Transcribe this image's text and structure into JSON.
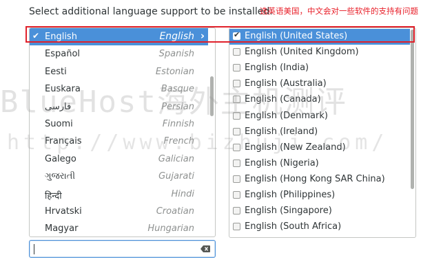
{
  "header": {
    "label": "Select additional language support to be installed:",
    "annotation": "选英语美国，中文会对一些软件的支持有问题"
  },
  "languages": [
    {
      "native": "English",
      "english": "English",
      "selected": true
    },
    {
      "native": "Español",
      "english": "Spanish"
    },
    {
      "native": "Eesti",
      "english": "Estonian"
    },
    {
      "native": "Euskara",
      "english": "Basque"
    },
    {
      "native": "فارسی",
      "english": "Persian"
    },
    {
      "native": "Suomi",
      "english": "Finnish"
    },
    {
      "native": "Français",
      "english": "French"
    },
    {
      "native": "Galego",
      "english": "Galician"
    },
    {
      "native": "ગુજરાતી",
      "english": "Gujarati"
    },
    {
      "native": "हिन्दी",
      "english": "Hindi"
    },
    {
      "native": "Hrvatski",
      "english": "Croatian"
    },
    {
      "native": "Magyar",
      "english": "Hungarian"
    }
  ],
  "locales": [
    {
      "label": "English (United States)",
      "checked": true,
      "selected": true
    },
    {
      "label": "English (United Kingdom)",
      "checked": false
    },
    {
      "label": "English (India)",
      "checked": false
    },
    {
      "label": "English (Australia)",
      "checked": false
    },
    {
      "label": "English (Canada)",
      "checked": false
    },
    {
      "label": "English (Denmark)",
      "checked": false
    },
    {
      "label": "English (Ireland)",
      "checked": false
    },
    {
      "label": "English (New Zealand)",
      "checked": false
    },
    {
      "label": "English (Nigeria)",
      "checked": false
    },
    {
      "label": "English (Hong Kong SAR China)",
      "checked": false
    },
    {
      "label": "English (Philippines)",
      "checked": false
    },
    {
      "label": "English (Singapore)",
      "checked": false
    },
    {
      "label": "English (South Africa)",
      "checked": false
    }
  ],
  "search": {
    "value": "",
    "clear_icon": "clear-icon"
  },
  "watermark": {
    "line1": "BlueHost海外主机测评",
    "line2": "http://www.bizhuji.com/"
  },
  "colors": {
    "selection": "#4a90d9",
    "annotation": "#e8202a"
  },
  "icons": {
    "selected_language": "checkmark-icon",
    "arrow": "chevron-right-icon",
    "checkbox": "checkbox-icon"
  }
}
